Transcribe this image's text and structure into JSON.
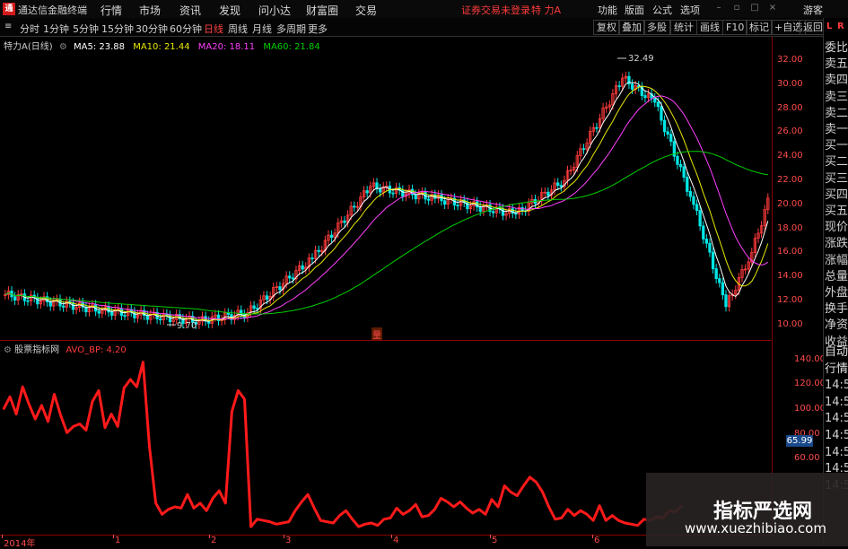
{
  "app": {
    "title": "通达信金融终端",
    "status": "证券交易未登录",
    "stock_name": "特 力A",
    "login": "游客"
  },
  "menu": [
    "行情",
    "市场",
    "资讯",
    "发现",
    "问小达",
    "财富圈",
    "交易"
  ],
  "menu_right": [
    "功能",
    "版面",
    "公式",
    "选项"
  ],
  "toolbar": {
    "periods": [
      "分时",
      "1分钟",
      "5分钟",
      "15分钟",
      "30分钟",
      "60分钟",
      "日线",
      "周线",
      "月线",
      "多周期",
      "更多"
    ],
    "active_period": "日线",
    "tools": [
      "复权",
      "叠加",
      "多股",
      "统计",
      "画线",
      "F10",
      "标记",
      "+自选",
      "返回"
    ]
  },
  "chart": {
    "name": "特力A",
    "period": "(日线)",
    "ma": [
      {
        "label": "MA5: 23.88",
        "color": "#ffffff"
      },
      {
        "label": "MA10: 21.44",
        "color": "#e8e800"
      },
      {
        "label": "MA20: 18.11",
        "color": "#ff40ff"
      },
      {
        "label": "MA60: 21.84",
        "color": "#00d000"
      }
    ],
    "price_ticks": [
      "32.00",
      "30.00",
      "28.00",
      "26.00",
      "24.00",
      "22.00",
      "20.00",
      "18.00",
      "16.00",
      "14.00",
      "12.00",
      "10.00"
    ],
    "high_label": "32.49",
    "low_label": "9.70",
    "marker": "量"
  },
  "chart_data": {
    "type": "line",
    "title": "",
    "series": [
      {
        "name": "AVO_BP",
        "values": [
          100,
          110,
          96,
          118,
          104,
          92,
          103,
          90,
          112,
          95,
          81,
          86,
          88,
          83,
          106,
          115,
          85,
          96,
          86,
          117,
          124,
          118,
          138,
          70,
          24,
          15,
          19,
          21,
          20,
          31,
          20,
          24,
          18,
          28,
          34,
          24,
          98,
          115,
          108,
          5,
          11,
          10,
          9,
          7,
          8,
          9,
          18,
          25,
          31,
          20,
          10,
          9,
          8,
          14,
          18,
          11,
          5,
          7,
          8,
          6,
          11,
          12,
          20,
          15,
          18,
          23,
          13,
          14,
          19,
          28,
          25,
          21,
          25,
          20,
          16,
          19,
          15,
          27,
          21,
          38,
          33,
          30,
          38,
          45,
          41,
          33,
          21,
          11,
          12,
          19,
          14,
          18,
          15,
          10,
          22,
          10,
          14,
          10,
          8,
          7,
          6,
          11,
          10,
          13,
          12,
          18,
          17,
          22
        ]
      }
    ],
    "ylim": [
      0,
      145
    ],
    "yticks": [
      "140.00",
      "120.00",
      "100.00",
      "80.00",
      "60.00"
    ],
    "current_value": "65.99",
    "xlabels": [
      "2014年",
      "1",
      "2",
      "3",
      "4",
      "5",
      "6"
    ]
  },
  "indicator": {
    "name": "股票指标网",
    "formula": "AVO_BP: 4.20"
  },
  "side_panel": {
    "quote_items": [
      "委比",
      "卖五",
      "卖四",
      "卖三",
      "卖二",
      "卖一",
      "买一",
      "买二",
      "买三",
      "买四",
      "买五",
      "现价",
      "涨跌",
      "涨幅",
      "总量",
      "外盘",
      "换手",
      "净资",
      "收益"
    ],
    "lower_items": [
      "自动",
      "行情",
      "14:5",
      "14:5",
      "14:5",
      "14:5",
      "14:5",
      "14:5",
      "14:5"
    ]
  },
  "watermark": {
    "title": "指标严选网",
    "url": "www.xuezhibiao.com"
  },
  "colors": {
    "up": "#ff3b3b",
    "down": "#00e5e5",
    "axis": "#ff4b4b",
    "ma60": "#00d000"
  }
}
